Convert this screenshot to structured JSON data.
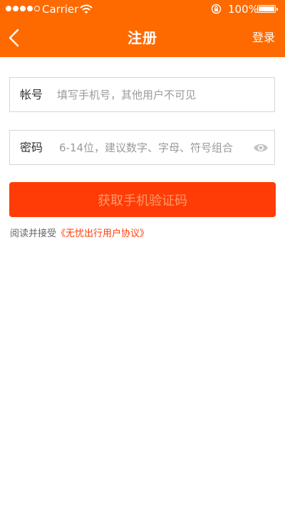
{
  "status_bar": {
    "carrier": "Carrier",
    "battery_text": "100%",
    "battery_level": 1.0,
    "signal_bars_filled": 4,
    "signal_bars_total": 5
  },
  "nav": {
    "title": "注册",
    "right_action": "登录",
    "back_icon": "chevron-left-icon"
  },
  "form": {
    "account": {
      "label": "帐号",
      "value": "",
      "placeholder": "填写手机号，其他用户不可见"
    },
    "password": {
      "label": "密码",
      "value": "",
      "placeholder": "6-14位，建议数字、字母、符号组合",
      "toggle_icon": "eye-icon"
    },
    "submit_label": "获取手机验证码"
  },
  "agreement": {
    "prefix": "阅读并接受",
    "link_text": "《无忧出行用户协议》"
  },
  "colors": {
    "header": "#ff6a00",
    "button": "#ff3c05",
    "button_text": "#ff9a6e",
    "link": "#ff3c05"
  }
}
